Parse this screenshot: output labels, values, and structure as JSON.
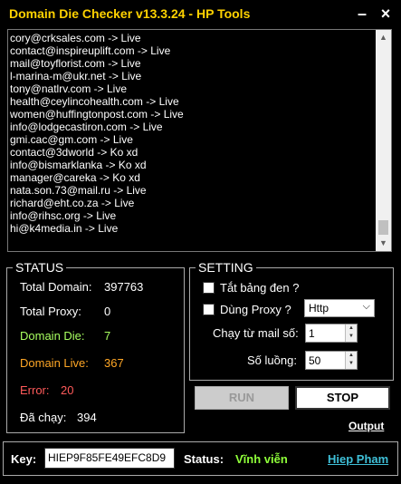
{
  "window": {
    "title": "Domain Die Checker v13.3.24 - HP Tools",
    "minimize_label": "–",
    "close_label": "×"
  },
  "log": {
    "lines": [
      "cory@crksales.com -> Live",
      "contact@inspireuplift.com -> Live",
      "mail@toyflorist.com -> Live",
      "l-marina-m@ukr.net -> Live",
      "tony@natlrv.com -> Live",
      "health@ceylincohealth.com -> Live",
      "women@huffingtonpost.com -> Live",
      "info@lodgecastiron.com -> Live",
      "gmi.cac@gm.com -> Live",
      "contact@3dworld -> Ko xd",
      "info@bismarklanka -> Ko xd",
      "manager@careka -> Ko xd",
      "nata.son.73@mail.ru -> Live",
      "richard@eht.co.za -> Live",
      "info@rihsc.org -> Live",
      "hi@k4media.in -> Live"
    ]
  },
  "status": {
    "title": "STATUS",
    "total_domain_label": "Total Domain:",
    "total_domain_value": "397763",
    "total_proxy_label": "Total Proxy:",
    "total_proxy_value": "0",
    "domain_die_label": "Domain Die:",
    "domain_die_value": "7",
    "domain_live_label": "Domain Live:",
    "domain_live_value": "367",
    "error_label": "Error:",
    "error_value": "20",
    "ran_label": "Đã chạy:",
    "ran_value": "394"
  },
  "setting": {
    "title": "SETTING",
    "black_table_label": "Tắt bảng đen ?",
    "use_proxy_label": "Dùng Proxy ?",
    "proxy_type_value": "Http",
    "start_mail_label": "Chạy từ mail số:",
    "start_mail_value": "1",
    "threads_label": "Số luồng:",
    "threads_value": "50"
  },
  "actions": {
    "run_label": "RUN",
    "stop_label": "STOP",
    "output_label": "Output"
  },
  "footer": {
    "key_label": "Key:",
    "key_value": "HIEP9F85FE49EFC8D9",
    "status_label": "Status:",
    "status_value": "Vĩnh viễn",
    "author_label": "Hiep Pham"
  },
  "colors": {
    "title": "#ffd200",
    "die": "#a8ff60",
    "live": "#ffa726",
    "error": "#ff5a5a",
    "status_value": "#8fff3a",
    "author_link": "#3fc0d8"
  }
}
